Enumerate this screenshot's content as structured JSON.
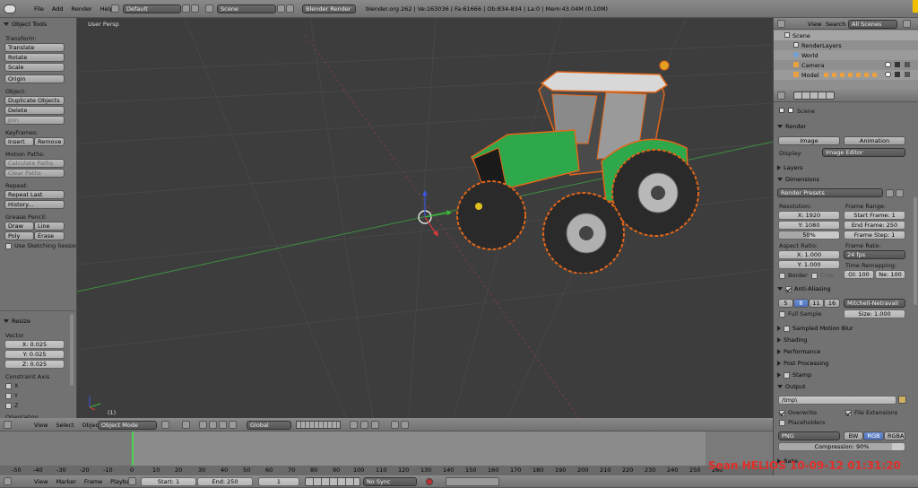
{
  "top_bar": {
    "menu": [
      "File",
      "Add",
      "Render",
      "Help"
    ],
    "layout": "Default",
    "scene": "Scene",
    "engine": "Blender Render",
    "info": "blender.org 262 | Ve:163036 | Fa:61666 | Ob:834-834 | La:0 | Mem:43.04M (0.10M)"
  },
  "tool_shelf": {
    "title": "Object Tools",
    "transform_label": "Transform:",
    "transform": [
      "Translate",
      "Rotate",
      "Scale"
    ],
    "origin": "Origin",
    "object_label": "Object:",
    "object_buttons": [
      "Duplicate Objects",
      "Delete",
      "Join"
    ],
    "keyframes_label": "Keyframes:",
    "insert": "Insert",
    "remove": "Remove",
    "motion_paths_label": "Motion Paths:",
    "motion_paths": [
      "Calculate Paths",
      "Clear Paths"
    ],
    "repeat_label": "Repeat:",
    "repeat": [
      "Repeat Last",
      "History..."
    ],
    "grease_label": "Grease Pencil:",
    "draw": "Draw",
    "line": "Line",
    "poly": "Poly",
    "erase": "Erase",
    "sketch": "Use Sketching Sessio"
  },
  "operator": {
    "title": "Resize",
    "vector_label": "Vector",
    "x": "X: 0.025",
    "y": "Y: 0.025",
    "z": "Z: 0.025",
    "constraint_label": "Constraint Axis",
    "axes": [
      "X",
      "Y",
      "Z"
    ],
    "orientation_label": "Orientation"
  },
  "viewport": {
    "label": "User Persp",
    "frame": "(1)"
  },
  "view_header": {
    "menu": [
      "View",
      "Select",
      "Object"
    ],
    "mode": "Object Mode",
    "orientation": "Global"
  },
  "outliner": {
    "menu": [
      "View",
      "Search"
    ],
    "filter": "All Scenes",
    "items": [
      "Scene",
      "RenderLayers",
      "World",
      "Camera",
      "Model"
    ]
  },
  "properties": {
    "scene": "Scene",
    "render_title": "Render",
    "image_btn": "Image",
    "animation_btn": "Animation",
    "display_label": "Display:",
    "display_value": "Image Editor",
    "layers": "Layers",
    "dimensions": "Dimensions",
    "presets": "Render Presets",
    "resolution_label": "Resolution:",
    "res_x": "X: 1920",
    "res_y": "Y: 1080",
    "res_pct": "50%",
    "frame_range_label": "Frame Range:",
    "start_frame": "Start Frame: 1",
    "end_frame": "End Frame: 250",
    "frame_step": "Frame Step: 1",
    "aspect_label": "Aspect Ratio:",
    "asp_x": "X: 1.000",
    "asp_y": "Y: 1.000",
    "frame_rate_label": "Frame Rate:",
    "fps": "24 fps",
    "time_remap_label": "Time Remapping:",
    "old": "Ol: 100",
    "new": "Ne: 100",
    "border": "Border",
    "crop": "Crop",
    "aa": "Anti-Aliasing",
    "aa_levels": [
      "5",
      "8",
      "11",
      "16"
    ],
    "aa_filter": "Mitchell-Netravali",
    "full_sample": "Full Sample",
    "size": "Size: 1.000",
    "motion_blur": "Sampled Motion Blur",
    "shading": "Shading",
    "performance": "Performance",
    "post": "Post Processing",
    "stamp": "Stamp",
    "output": "Output",
    "path": "/tmp\\",
    "overwrite": "Overwrite",
    "file_ext": "File Extensions",
    "placeholders": "Placeholders",
    "format": "PNG",
    "bw": "BW",
    "rgb": "RGB",
    "rgba": "RGBA",
    "compression": "Compression: 90%",
    "bake": "Bake"
  },
  "timeline": {
    "ticks": [
      "-50",
      "-40",
      "-30",
      "-20",
      "-10",
      "0",
      "10",
      "20",
      "30",
      "40",
      "50",
      "60",
      "70",
      "80",
      "90",
      "100",
      "110",
      "120",
      "130",
      "140",
      "150",
      "160",
      "170",
      "180",
      "190",
      "200",
      "210",
      "220",
      "230",
      "240",
      "250",
      "260"
    ],
    "menu": [
      "View",
      "Marker",
      "Frame",
      "Playback"
    ],
    "start": "Start: 1",
    "end": "End: 250",
    "current": "1",
    "sync": "No Sync"
  },
  "watermark": "Sean HELIOS 10-09-12 01:31:20",
  "colors": {
    "accent": "#6b8fd4",
    "tractor_green": "#2ea84a",
    "timeline_cursor": "#4fd04f",
    "watermark": "#e0302a"
  }
}
